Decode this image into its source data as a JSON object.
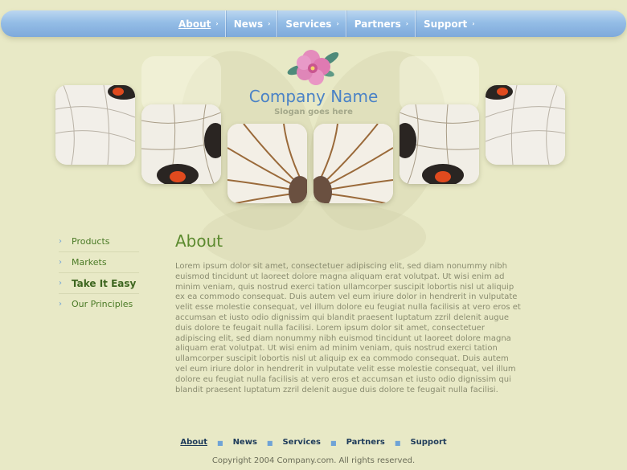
{
  "top_nav": {
    "items": [
      {
        "label": "About",
        "active": true
      },
      {
        "label": "News",
        "active": false
      },
      {
        "label": "Services",
        "active": false
      },
      {
        "label": "Partners",
        "active": false
      },
      {
        "label": "Support",
        "active": false
      }
    ]
  },
  "header": {
    "company_name": "Company Name",
    "slogan": "Slogan goes here",
    "logo_icon": "pink-flower-icon"
  },
  "side_nav": {
    "items": [
      {
        "label": "Products",
        "active": false
      },
      {
        "label": "Markets",
        "active": false
      },
      {
        "label": "Take It Easy",
        "active": true
      },
      {
        "label": "Our Principles",
        "active": false
      }
    ]
  },
  "main": {
    "title": "About",
    "body": "Lorem ipsum dolor sit amet, consectetuer adipiscing elit, sed diam nonummy nibh euismod tincidunt ut laoreet dolore magna aliquam erat volutpat. Ut wisi enim ad minim veniam, quis nostrud exerci tation ullamcorper suscipit lobortis nisl ut aliquip ex ea commodo consequat. Duis autem vel eum iriure dolor in hendrerit in vulputate velit esse molestie consequat, vel illum dolore eu feugiat nulla facilisis at vero eros et accumsan et iusto odio dignissim qui blandit praesent luptatum zzril delenit augue duis dolore te feugait nulla facilisi. Lorem ipsum dolor sit amet, consectetuer adipiscing elit, sed diam nonummy nibh euismod tincidunt ut laoreet dolore magna aliquam erat volutpat. Ut wisi enim ad minim veniam, quis nostrud exerci tation ullamcorper suscipit lobortis nisl ut aliquip ex ea commodo consequat. Duis autem vel eum iriure dolor in hendrerit in vulputate velit esse molestie consequat, vel illum dolore eu feugiat nulla facilisis at vero eros et accumsan et iusto odio dignissim qui blandit praesent luptatum zzril delenit augue duis dolore te feugait nulla facilisi."
  },
  "footer": {
    "items": [
      {
        "label": "About",
        "active": true
      },
      {
        "label": "News",
        "active": false
      },
      {
        "label": "Services",
        "active": false
      },
      {
        "label": "Partners",
        "active": false
      },
      {
        "label": "Support",
        "active": false
      }
    ],
    "copyright": "Copyright 2004 Company.com. All rights reserved."
  },
  "colors": {
    "background": "#e8e9c6",
    "nav_blue": "#94bde6",
    "title_green": "#5b8a2e",
    "company_blue": "#4a82c6"
  }
}
